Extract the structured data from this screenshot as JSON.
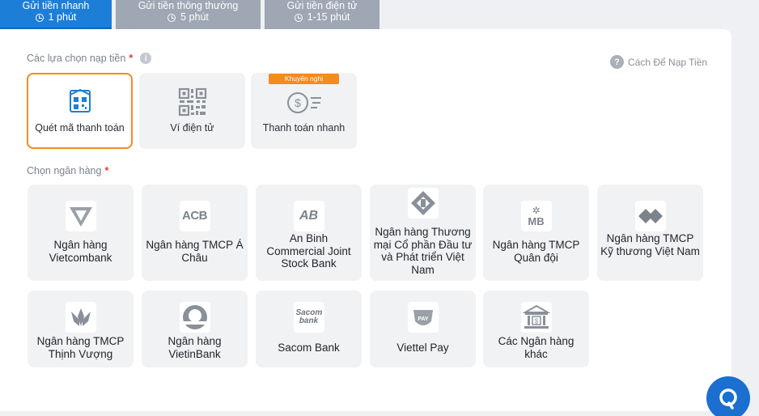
{
  "tabs": [
    {
      "title": "Gửi tiền nhanh",
      "time": "1 phút"
    },
    {
      "title": "Gửi tiền thông thường",
      "time": "5 phút"
    },
    {
      "title": "Gửi tiền điện tử",
      "time": "1-15 phút"
    }
  ],
  "deposit_options": {
    "label": "Các lựa chọn nạp tiền",
    "required_mark": "*",
    "info_glyph": "i",
    "help_glyph": "?",
    "help_link": "Cách Để Nạp Tiền",
    "items": [
      {
        "label": "Quét mã thanh toán",
        "icon": "qr-scan-icon",
        "selected": true
      },
      {
        "label": "Ví điện tử",
        "icon": "qr-code-icon"
      },
      {
        "label": "Thanh toán nhanh",
        "icon": "fast-payment-icon",
        "badge": "Khuyến nghị"
      }
    ]
  },
  "banks": {
    "label": "Chọn ngân hàng",
    "required_mark": "*",
    "items": [
      {
        "name": "Ngân hàng Vietcombank",
        "logo": "vietcombank-logo"
      },
      {
        "name": "Ngân hàng TMCP Á Châu",
        "logo": "acb-logo",
        "logo_text": "ACB"
      },
      {
        "name": "An Binh Commercial Joint Stock Bank",
        "logo": "abbank-logo",
        "logo_text": "AB"
      },
      {
        "name": "Ngân hàng Thương mại Cổ phần Đầu tư và Phát triển Việt Nam",
        "logo": "bidv-logo"
      },
      {
        "name": "Ngân hàng TMCP Quân đội",
        "logo": "mbbank-logo",
        "logo_text": "MB"
      },
      {
        "name": "Ngân hàng TMCP Kỹ thương Việt Nam",
        "logo": "techcombank-logo"
      },
      {
        "name": "Ngân hàng TMCP Thịnh Vượng",
        "logo": "vpbank-logo"
      },
      {
        "name": "Ngân hàng VietinBank",
        "logo": "vietinbank-logo"
      },
      {
        "name": "Sacom Bank",
        "logo": "sacombank-logo",
        "logo_text": "Sacom bank"
      },
      {
        "name": "Viettel Pay",
        "logo": "viettelpay-logo",
        "logo_text": "PAY"
      },
      {
        "name": "Các Ngân hàng khác",
        "logo": "bank-building-icon"
      }
    ]
  },
  "colors": {
    "primary": "#1d7ed8",
    "accent": "#f58a1f",
    "tab_inactive": "#9ea7b3",
    "card_bg": "#f1f2f4"
  }
}
